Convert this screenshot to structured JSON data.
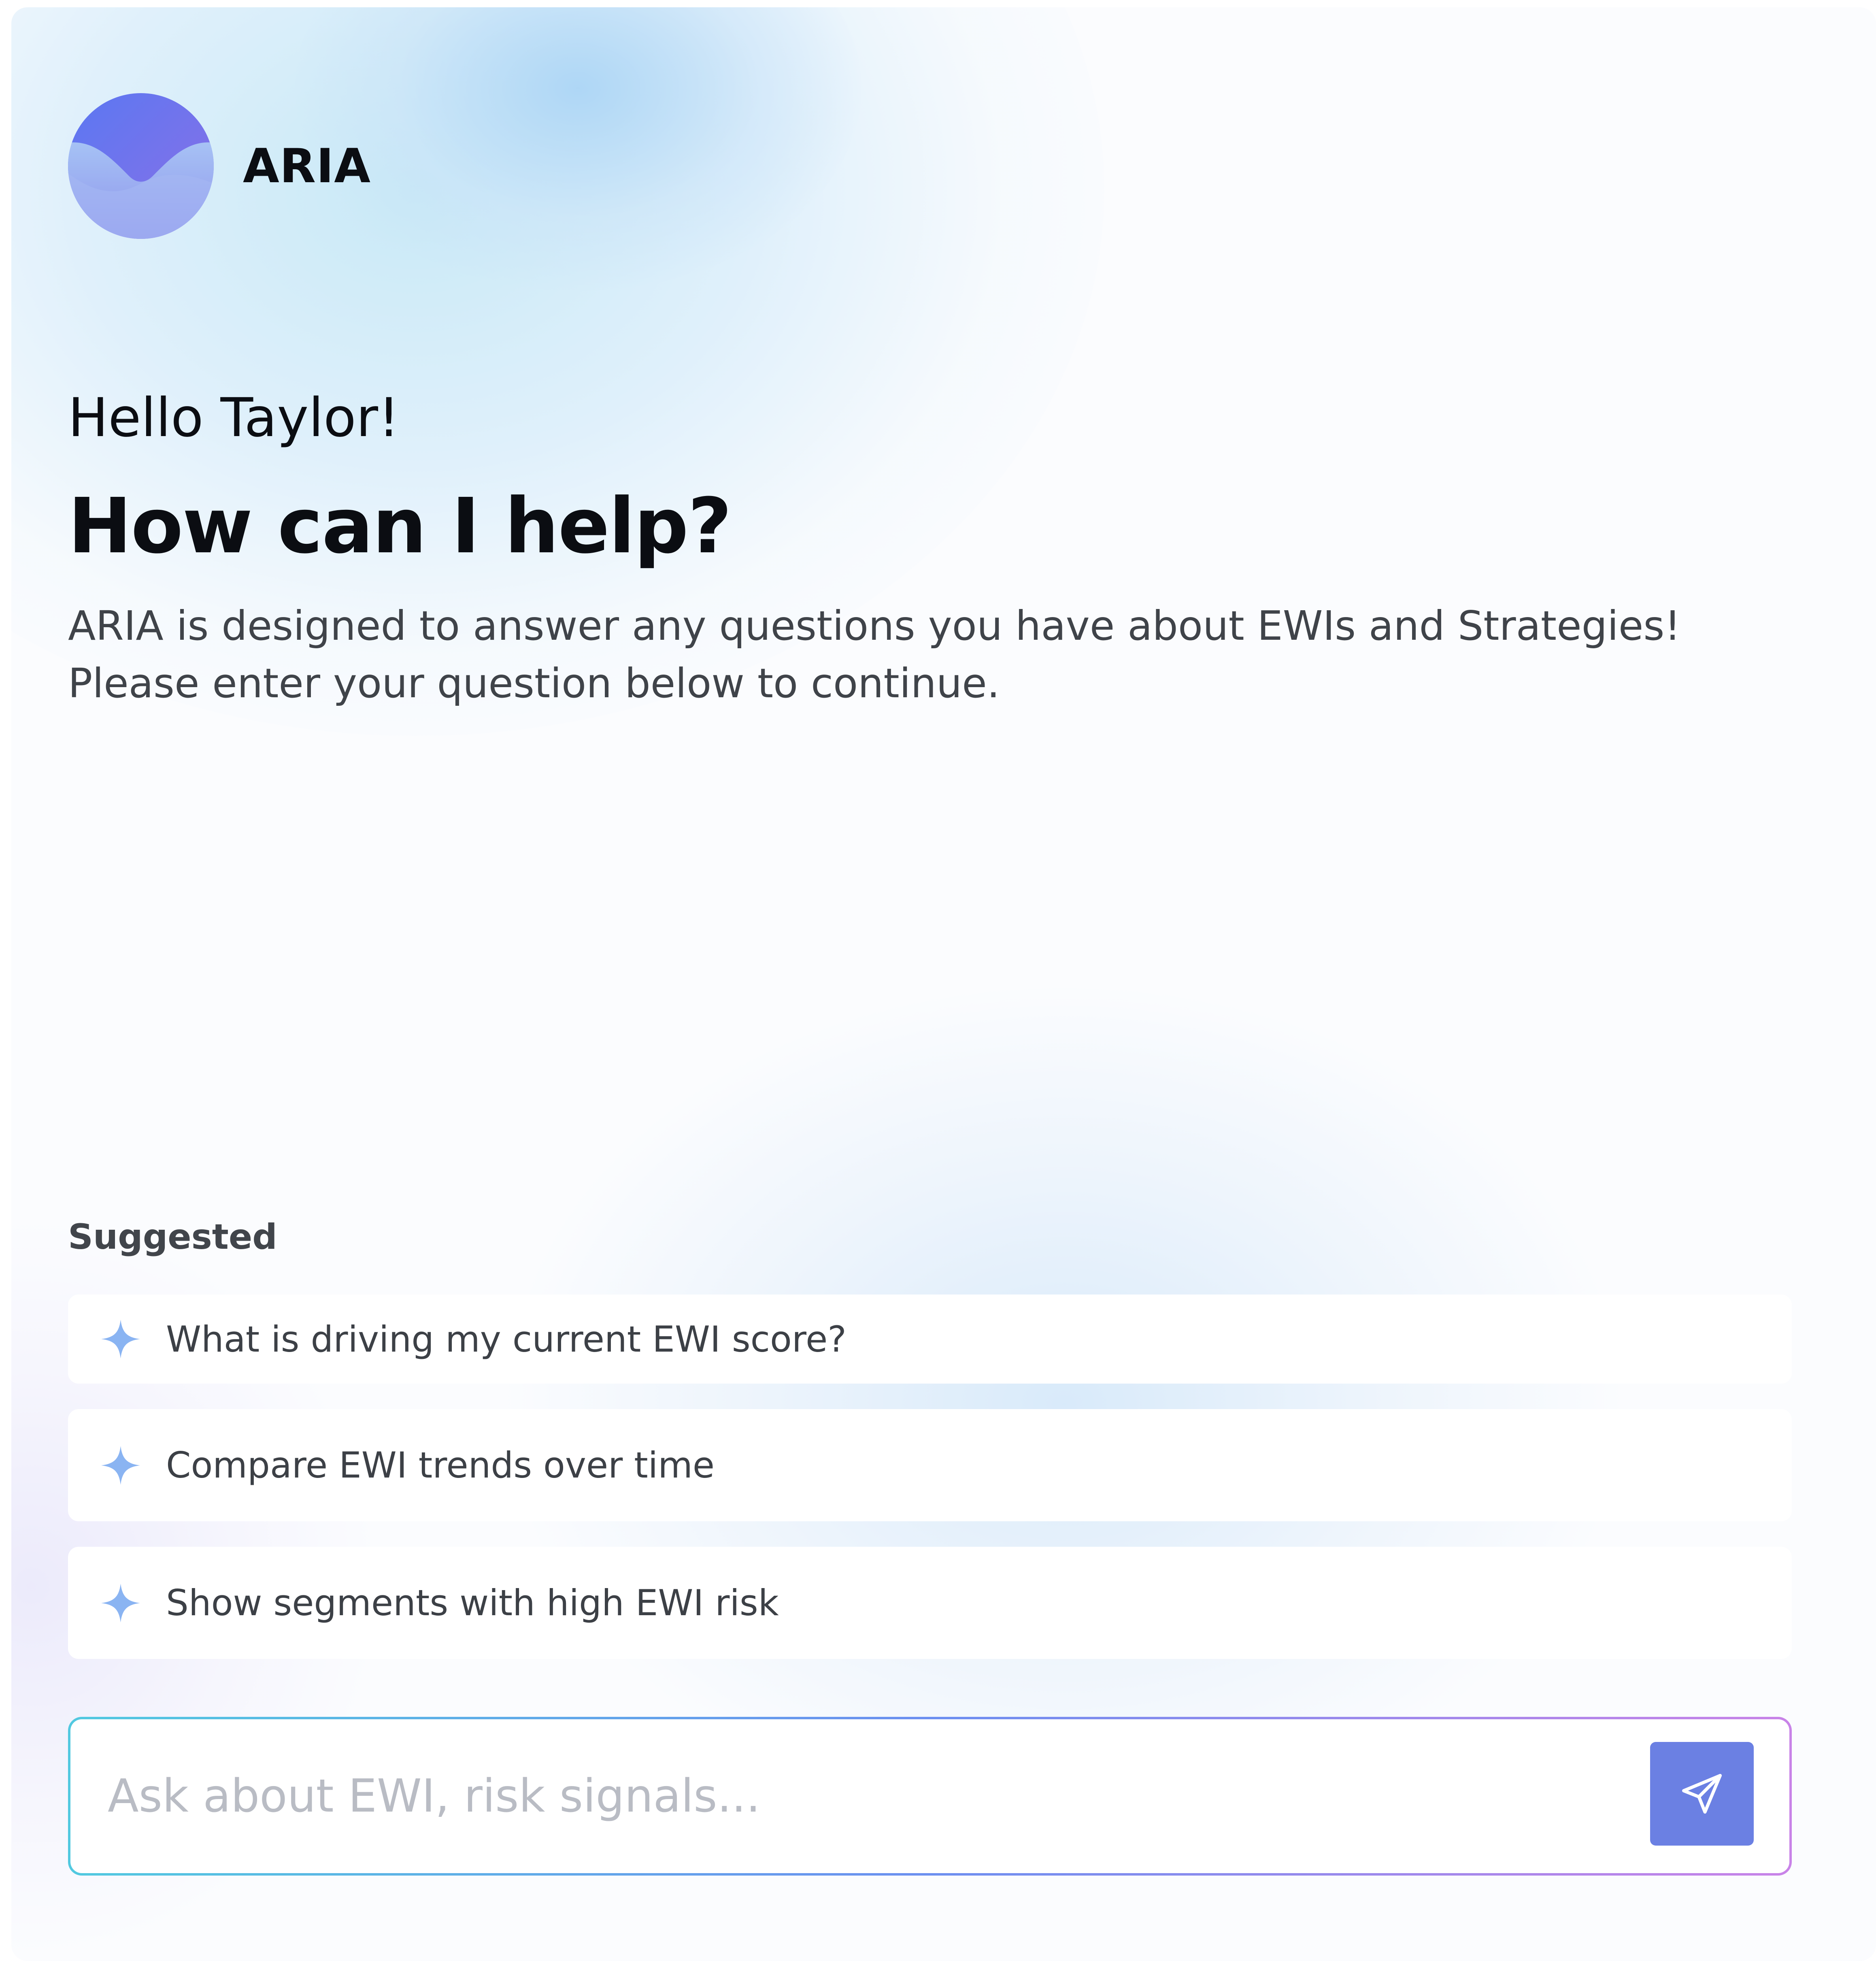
{
  "assistant": {
    "name": "ARIA"
  },
  "welcome": {
    "greeting": "Hello Taylor!",
    "headline": "How can I help?",
    "description": "ARIA is designed to answer any questions you have about EWIs and Strategies! Please enter your question below to continue."
  },
  "suggested": {
    "label": "Suggested",
    "items": [
      {
        "label": "What is driving my current EWI score?",
        "icon": "sparkle-icon"
      },
      {
        "label": "Compare EWI trends over time",
        "icon": "sparkle-icon"
      },
      {
        "label": "Show segments with high EWI risk",
        "icon": "sparkle-icon"
      }
    ]
  },
  "chat_input": {
    "placeholder": "Ask about EWI, risk signals...",
    "value": "",
    "send_icon": "send-icon"
  },
  "colors": {
    "accent": "#6b80e3",
    "sparkle": "#8ab4f2",
    "input_border_start": "#52c9e0",
    "input_border_end": "#c983e8"
  }
}
